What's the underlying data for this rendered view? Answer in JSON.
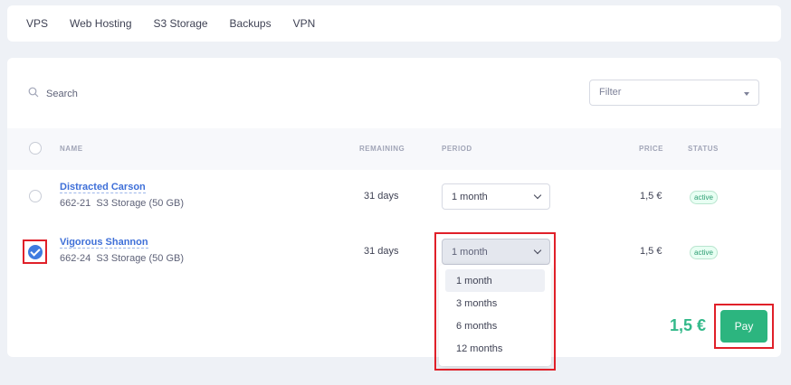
{
  "nav": {
    "tabs": [
      {
        "label": "VPS"
      },
      {
        "label": "Web Hosting"
      },
      {
        "label": "S3 Storage"
      },
      {
        "label": "Backups"
      },
      {
        "label": "VPN"
      }
    ]
  },
  "search": {
    "placeholder": "Search"
  },
  "filter": {
    "placeholder": "Filter"
  },
  "table": {
    "headers": {
      "name": "NAME",
      "remaining": "REMAINING",
      "period": "PERIOD",
      "price": "PRICE",
      "status": "STATUS"
    },
    "rows": [
      {
        "name": "Distracted Carson",
        "id": "662-21",
        "product": "S3 Storage (50 GB)",
        "remaining": "31 days",
        "period": "1 month",
        "price": "1,5 €",
        "status": "active",
        "selected": false
      },
      {
        "name": "Vigorous Shannon",
        "id": "662-24",
        "product": "S3 Storage (50 GB)",
        "remaining": "31 days",
        "period": "1 month",
        "price": "1,5 €",
        "status": "active",
        "selected": true
      }
    ]
  },
  "period_dropdown": {
    "options": [
      "1 month",
      "3 months",
      "6 months",
      "12 months"
    ],
    "highlighted": "1 month"
  },
  "footer": {
    "total": "1,5 €",
    "pay_label": "Pay"
  },
  "colors": {
    "accent_blue": "#3e7be0",
    "pay_green": "#2cb57f",
    "total_green": "#33b98a",
    "highlight_red": "#e02029"
  }
}
